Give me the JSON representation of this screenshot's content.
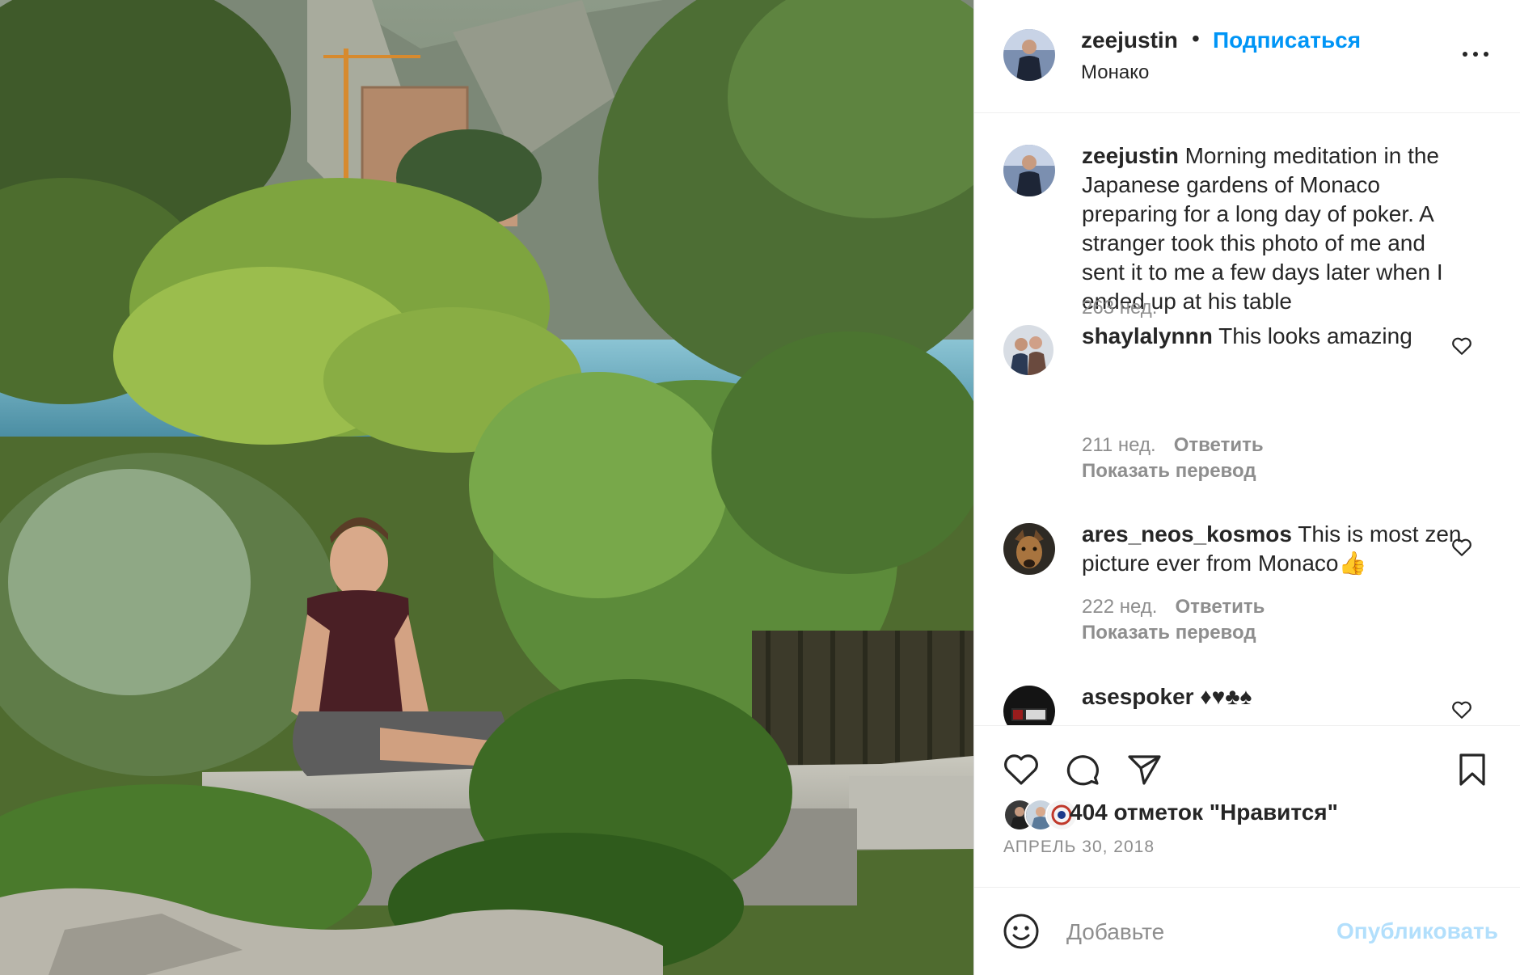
{
  "post": {
    "username": "zeejustin",
    "follow_label": "Подписаться",
    "separator": "•",
    "location": "Монако"
  },
  "caption": {
    "username": "zeejustin",
    "text": "Morning meditation in the Japanese gardens of Monaco preparing for a long day of poker. A stranger took this photo of me and sent it to me a few days later when I ended up at his table",
    "time": "263 нед."
  },
  "comments": [
    {
      "username": "shaylalynnn",
      "text": "This looks amazing",
      "time": "211 нед.",
      "reply": "Ответить",
      "translate": "Показать перевод"
    },
    {
      "username": "ares_neos_kosmos",
      "text": "This is most zen picture ever from Monaco👍",
      "time": "222 нед.",
      "reply": "Ответить",
      "translate": "Показать перевод"
    },
    {
      "username": "asespoker",
      "text": "♦♥♣♠"
    }
  ],
  "likes": {
    "text": "404 отметок \"Нравится\"",
    "count": 404
  },
  "date": "АПРЕЛЬ 30, 2018",
  "composer": {
    "placeholder": "Добавьте",
    "publish_label": "Опубликовать"
  },
  "icons": {
    "like": "heart-icon",
    "comment": "comment-bubble-icon",
    "share": "paper-plane-icon",
    "save": "bookmark-icon",
    "more": "more-horizontal-icon",
    "emoji": "emoji-smile-icon",
    "comment_like": "heart-outline-icon"
  },
  "colors": {
    "link": "#0095f6",
    "text": "#262626",
    "secondary": "#8e8e8e",
    "publish_disabled": "#b2dffc",
    "divider": "#efefef"
  }
}
